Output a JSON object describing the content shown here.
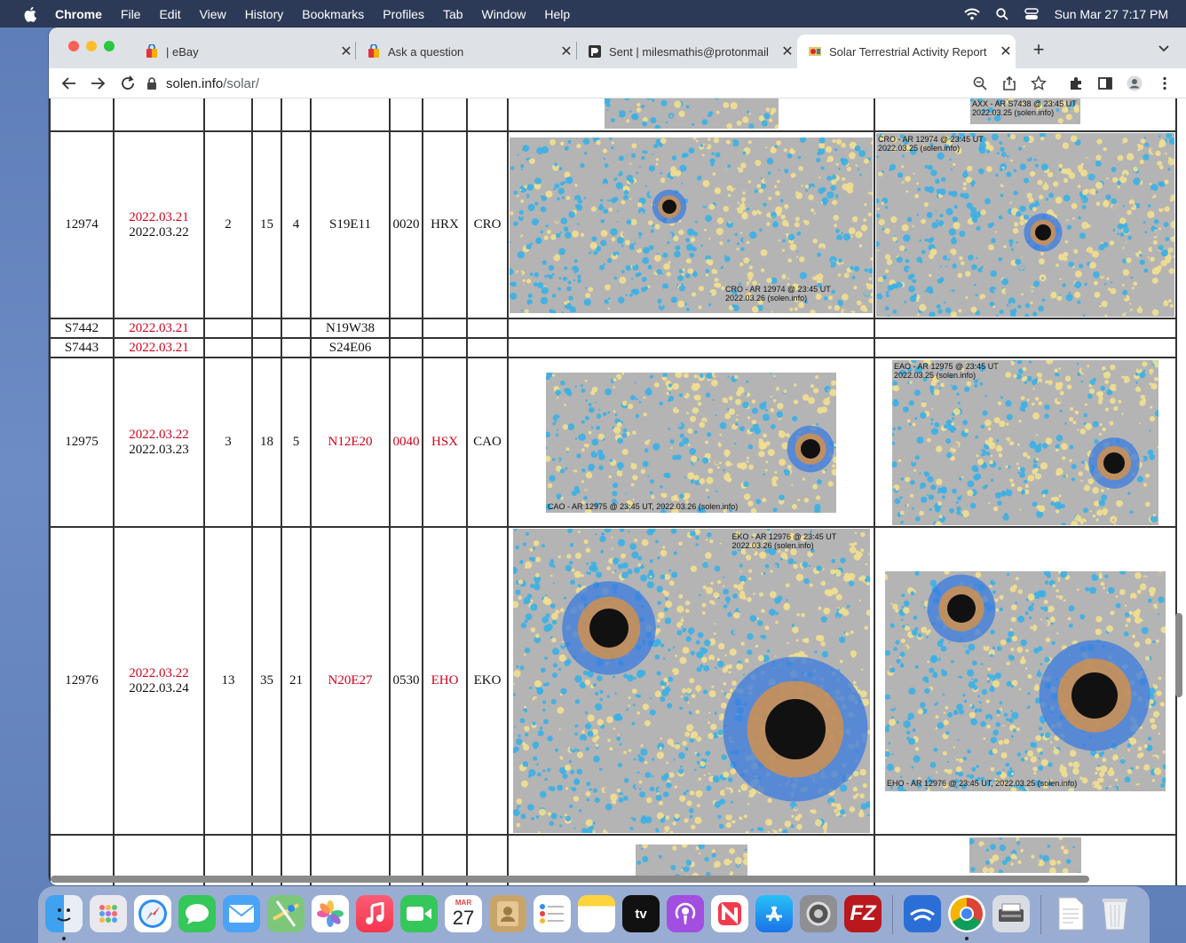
{
  "menubar": {
    "app_name": "Chrome",
    "items": [
      "File",
      "Edit",
      "View",
      "History",
      "Bookmarks",
      "Profiles",
      "Tab",
      "Window",
      "Help"
    ],
    "datetime": "Sun Mar 27  7:17 PM"
  },
  "browser": {
    "tabs": [
      {
        "title": "| eBay",
        "active": false
      },
      {
        "title": "Ask a question",
        "active": false
      },
      {
        "title": "Sent | milesmathis@protonmail",
        "active": false
      },
      {
        "title": "Solar Terrestrial Activity Report",
        "active": true
      }
    ],
    "new_tab_label": "+",
    "url_host": "solen.info",
    "url_path": "/solar/"
  },
  "table": {
    "rows": [
      {
        "region": "12974",
        "date1": "2022.03.21",
        "date2": "2022.03.22",
        "c1": "2",
        "c2": "15",
        "c3": "4",
        "location": "S19E11",
        "area": "0020",
        "class1": "HRX",
        "class2": "CRO",
        "caption_left": "CRO - AR 12974 @ 23:45 UT\n2022.03.26 (solen.info)",
        "caption_right": "CRO - AR 12974 @ 23:45 UT\n2022.03.25 (solen.info)"
      },
      {
        "region": "S7442",
        "date1": "2022.03.21",
        "location": "N19W38"
      },
      {
        "region": "S7443",
        "date1": "2022.03.21",
        "location": "S24E06"
      },
      {
        "region": "12975",
        "date1": "2022.03.22",
        "date2": "2022.03.23",
        "c1": "3",
        "c2": "18",
        "c3": "5",
        "location": "N12E20",
        "area": "0040",
        "class1": "HSX",
        "class2": "CAO",
        "caption_left": "CAO - AR 12975 @ 23:45 UT, 2022.03.26 (solen.info)",
        "caption_right": "EAO - AR 12975 @ 23:45 UT\n2022.03.25 (solen.info)"
      },
      {
        "region": "12976",
        "date1": "2022.03.22",
        "date2": "2022.03.24",
        "c1": "13",
        "c2": "35",
        "c3": "21",
        "location": "N20E27",
        "area": "0530",
        "class1": "EHO",
        "class2": "EKO",
        "caption_left": "EKO - AR 12976 @ 23:45 UT\n2022.03.26 (solen.info)",
        "caption_right": "EHO - AR 12976 @ 23:45 UT, 2022.03.25 (solen.info)"
      }
    ],
    "top_caption_right": "AXX - AR S7438 @ 23:45 UT\n2022.03.25 (solen.info)"
  },
  "dock": {
    "calendar_month": "MAR",
    "calendar_day": "27",
    "tv_label": "tv",
    "filezilla_label": "FZ"
  },
  "colors": {
    "menubar": "#2d3a57",
    "tabbar": "#dee1e6",
    "red_text": "#d0021b",
    "magneto_gray": "#b4b4b4",
    "magneto_yellow": "#f2df8f",
    "magneto_blue": "#3ab0e6"
  }
}
